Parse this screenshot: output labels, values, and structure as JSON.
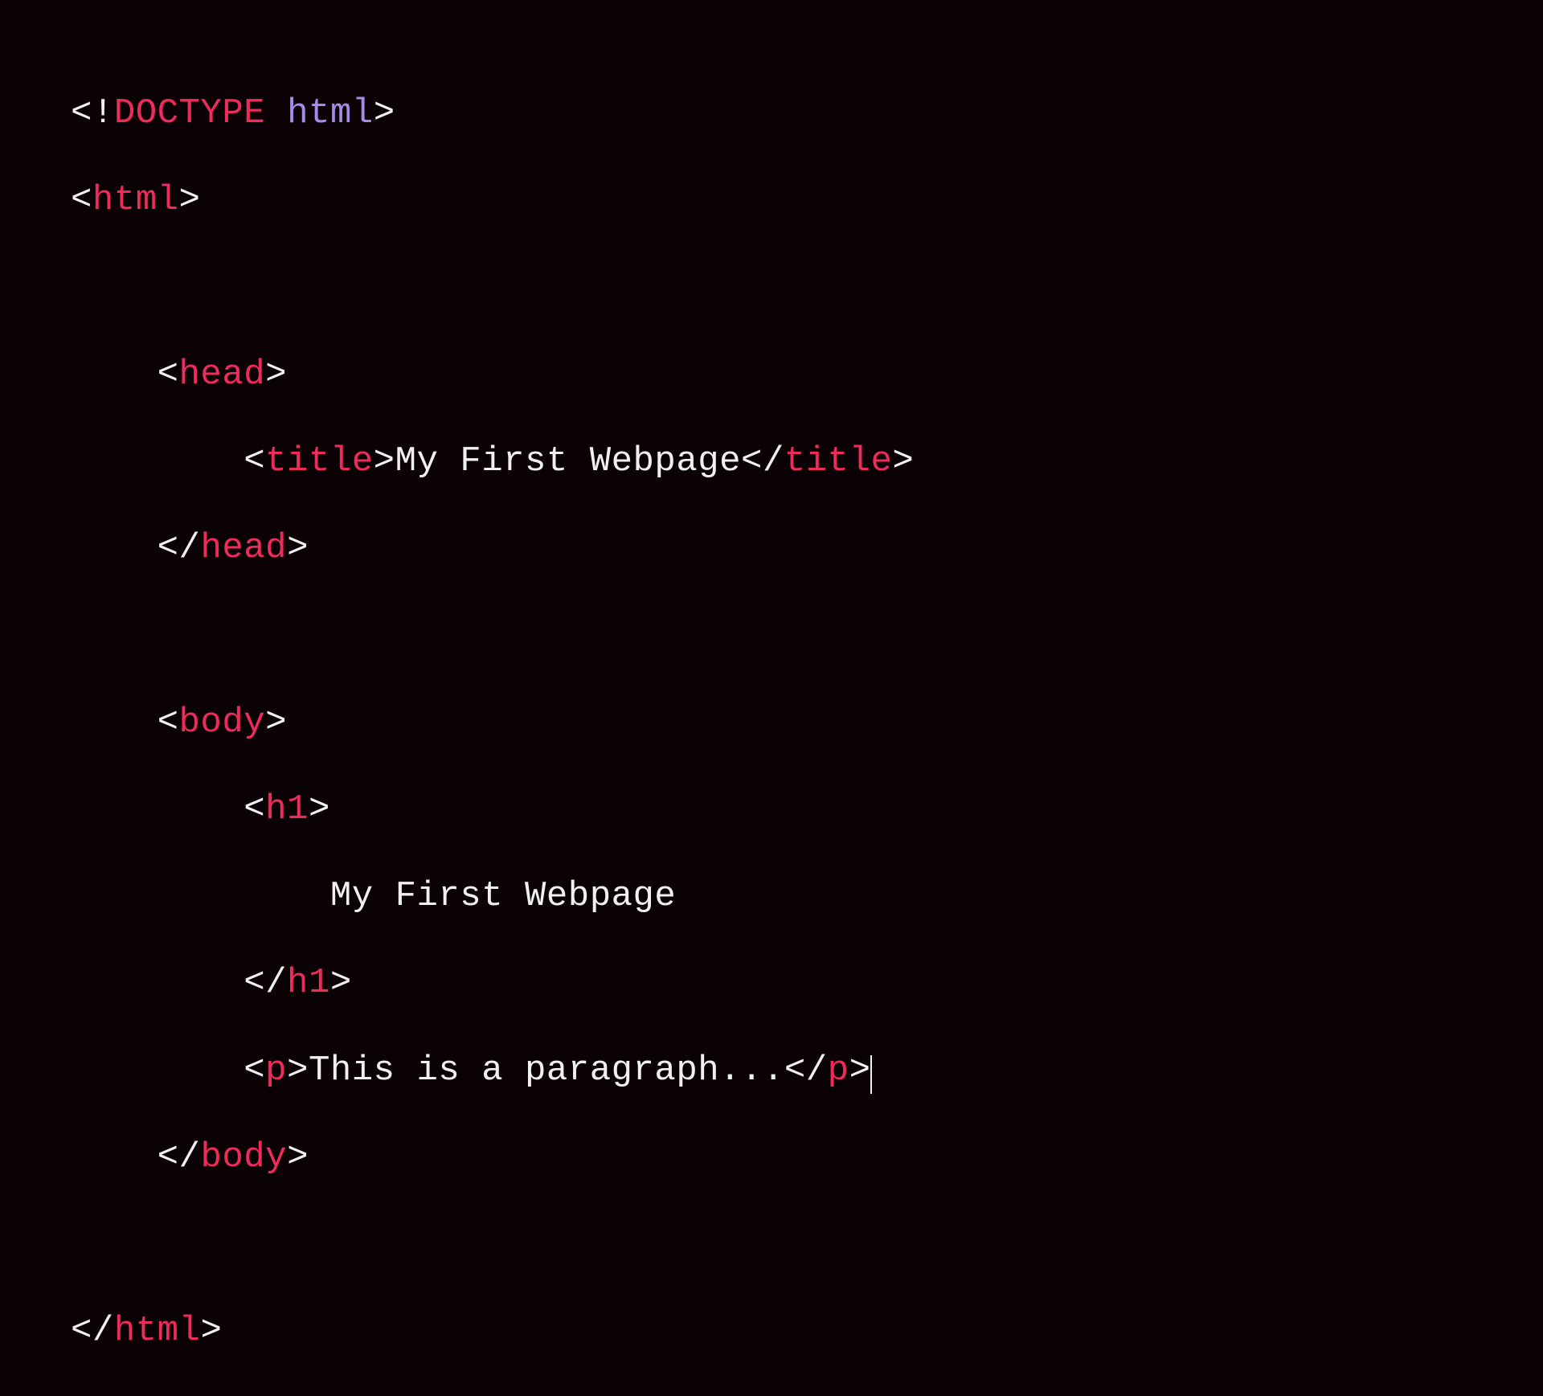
{
  "code": {
    "line1": {
      "open": "<!",
      "doctype": "DOCTYPE",
      "space": " ",
      "html": "html",
      "close": ">"
    },
    "line2": {
      "open": "<",
      "tag": "html",
      "close": ">"
    },
    "line4": {
      "open": "<",
      "tag": "head",
      "close": ">"
    },
    "line5": {
      "open": "<",
      "tag1": "title",
      "close1": ">",
      "text": "My First Webpage",
      "open2": "</",
      "tag2": "title",
      "close2": ">"
    },
    "line6": {
      "open": "</",
      "tag": "head",
      "close": ">"
    },
    "line8": {
      "open": "<",
      "tag": "body",
      "close": ">"
    },
    "line9": {
      "open": "<",
      "tag": "h1",
      "close": ">"
    },
    "line10": {
      "text": "My First Webpage"
    },
    "line11": {
      "open": "</",
      "tag": "h1",
      "close": ">"
    },
    "line12": {
      "open": "<",
      "tag1": "p",
      "close1": ">",
      "text": "This is a paragraph...",
      "open2": "</",
      "tag2": "p",
      "close2": ">"
    },
    "line13": {
      "open": "</",
      "tag": "body",
      "close": ">"
    },
    "line15": {
      "open": "</",
      "tag": "html",
      "close": ">"
    }
  }
}
